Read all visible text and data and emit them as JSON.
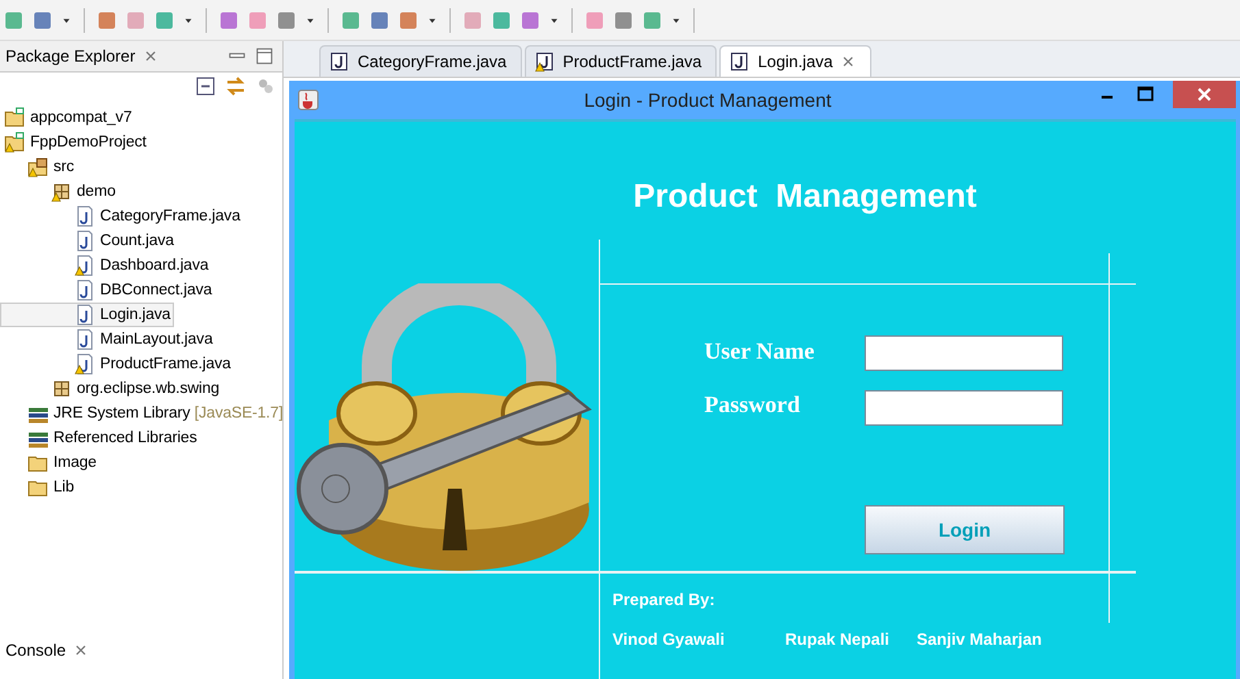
{
  "package_explorer": {
    "title": "Package Explorer",
    "tree": [
      {
        "label": "appcompat_v7",
        "kind": "project",
        "warning": false,
        "selected": false
      },
      {
        "label": "FppDemoProject",
        "kind": "project",
        "warning": true,
        "selected": false,
        "children": [
          {
            "label": "src",
            "kind": "source",
            "warning": true,
            "selected": false,
            "children": [
              {
                "label": "demo",
                "kind": "package",
                "warning": true,
                "selected": false,
                "children": [
                  {
                    "label": "CategoryFrame.java",
                    "kind": "java",
                    "warning": false,
                    "selected": false
                  },
                  {
                    "label": "Count.java",
                    "kind": "java",
                    "warning": false,
                    "selected": false
                  },
                  {
                    "label": "Dashboard.java",
                    "kind": "java",
                    "warning": true,
                    "selected": false
                  },
                  {
                    "label": "DBConnect.java",
                    "kind": "java",
                    "warning": false,
                    "selected": false
                  },
                  {
                    "label": "Login.java",
                    "kind": "java",
                    "warning": false,
                    "selected": true
                  },
                  {
                    "label": "MainLayout.java",
                    "kind": "java",
                    "warning": false,
                    "selected": false
                  },
                  {
                    "label": "ProductFrame.java",
                    "kind": "java",
                    "warning": true,
                    "selected": false
                  }
                ]
              },
              {
                "label": "org.eclipse.wb.swing",
                "kind": "package",
                "warning": false,
                "selected": false
              }
            ]
          },
          {
            "label": "JRE System Library",
            "suffix": "[JavaSE-1.7]",
            "kind": "library",
            "warning": false,
            "selected": false
          },
          {
            "label": "Referenced Libraries",
            "kind": "library",
            "warning": false,
            "selected": false
          },
          {
            "label": "Image",
            "kind": "folder",
            "warning": false,
            "selected": false
          },
          {
            "label": "Lib",
            "kind": "folder",
            "warning": false,
            "selected": false
          }
        ]
      }
    ]
  },
  "console": {
    "title": "Console"
  },
  "editor_tabs": [
    {
      "label": "CategoryFrame.java",
      "warning": false,
      "selected": false
    },
    {
      "label": "ProductFrame.java",
      "warning": true,
      "selected": false
    },
    {
      "label": "Login.java",
      "warning": false,
      "selected": true
    }
  ],
  "login_window": {
    "title": "Login - Product Management",
    "heading": "Product  Management",
    "fields": [
      {
        "label": "User Name"
      },
      {
        "label": "Password"
      }
    ],
    "button": "Login",
    "prepared_by": "Prepared By:",
    "authors": [
      "Vinod Gyawali",
      "Rupak Nepali",
      "Sanjiv Maharjan"
    ]
  }
}
